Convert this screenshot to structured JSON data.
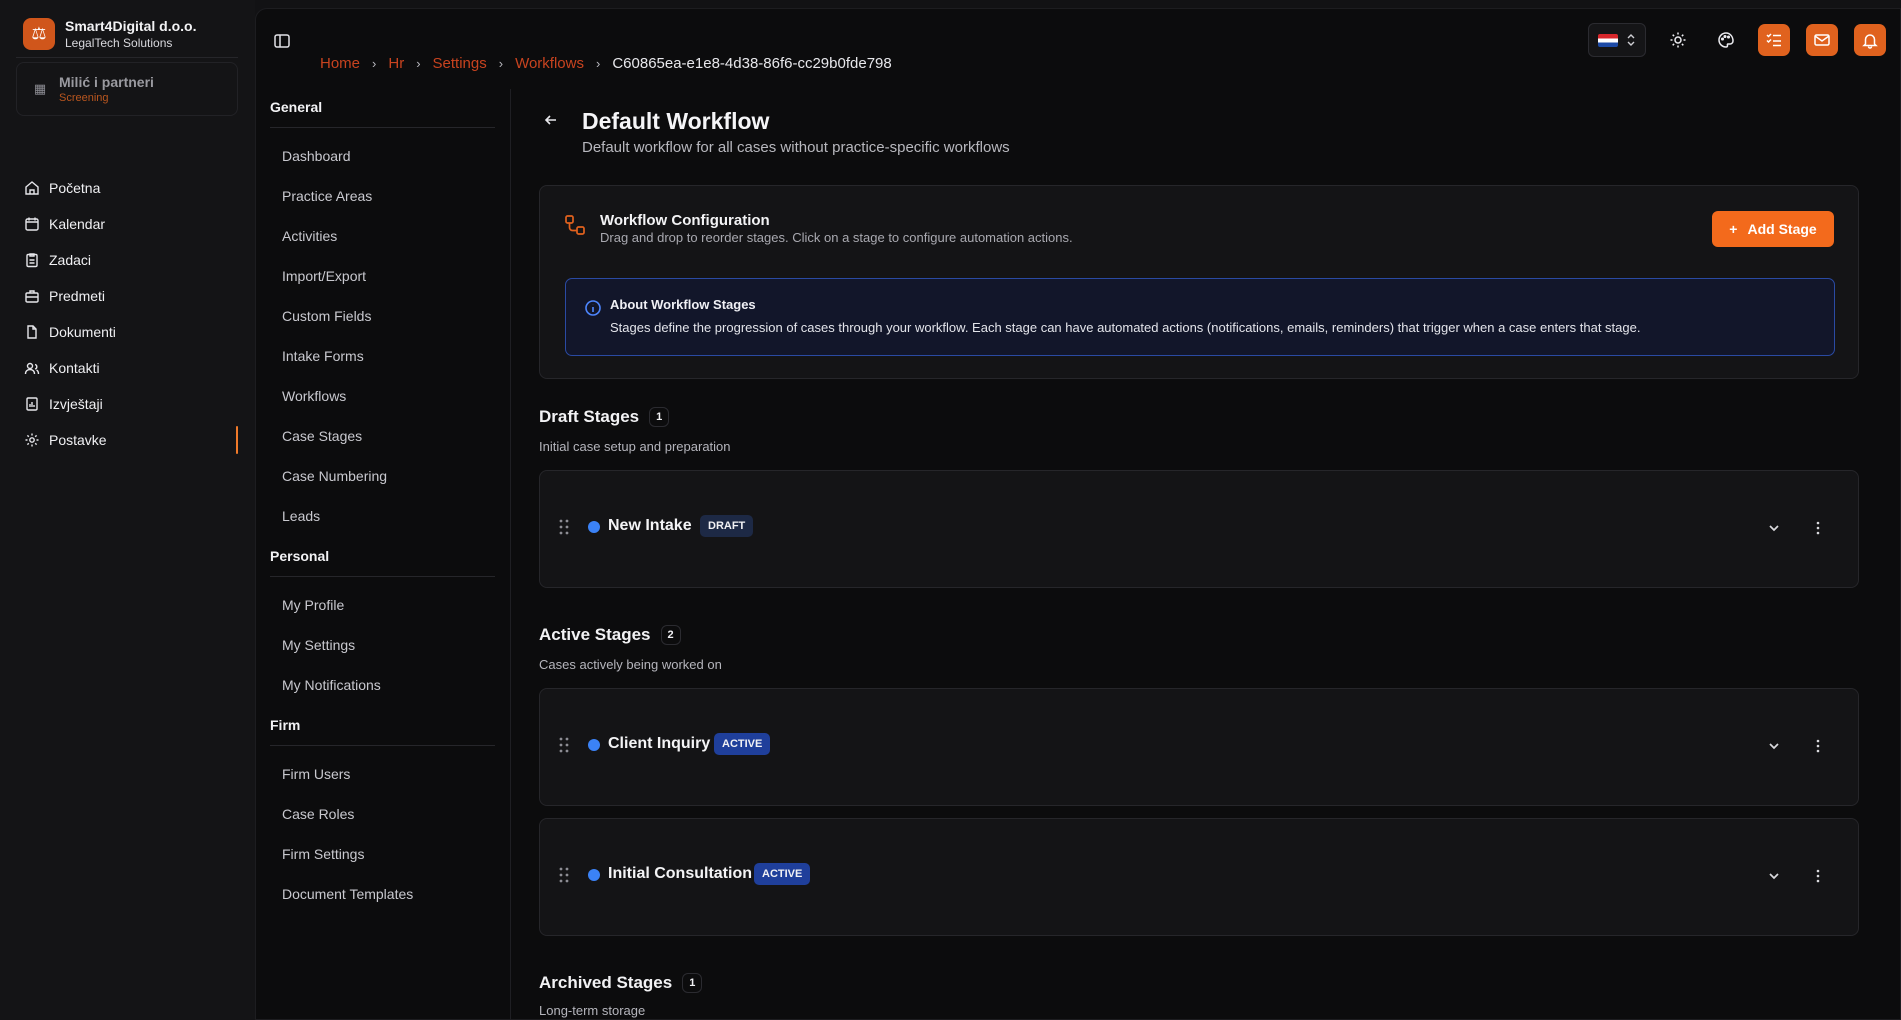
{
  "org": {
    "name": "Smart4Digital d.o.o.",
    "subtitle": "LegalTech Solutions"
  },
  "firm": {
    "name": "Milić i partneri",
    "status": "Screening"
  },
  "nav": [
    {
      "label": "Početna",
      "icon": "home-icon"
    },
    {
      "label": "Kalendar",
      "icon": "calendar-icon"
    },
    {
      "label": "Zadaci",
      "icon": "clipboard-icon"
    },
    {
      "label": "Predmeti",
      "icon": "briefcase-icon"
    },
    {
      "label": "Dokumenti",
      "icon": "file-icon"
    },
    {
      "label": "Kontakti",
      "icon": "users-icon"
    },
    {
      "label": "Izvještaji",
      "icon": "report-icon"
    },
    {
      "label": "Postavke",
      "icon": "gear-icon"
    }
  ],
  "breadcrumb": {
    "items": [
      "Home",
      "Hr",
      "Settings",
      "Workflows"
    ],
    "current": "C60865ea-e1e8-4d38-86f6-cc29b0fde798"
  },
  "settings_nav": {
    "general_title": "General",
    "general": [
      "Dashboard",
      "Practice Areas",
      "Activities",
      "Import/Export",
      "Custom Fields",
      "Intake Forms",
      "Workflows",
      "Case Stages",
      "Case Numbering",
      "Leads"
    ],
    "personal_title": "Personal",
    "personal": [
      "My Profile",
      "My Settings",
      "My Notifications"
    ],
    "firm_title": "Firm",
    "firm": [
      "Firm Users",
      "Case Roles",
      "Firm Settings",
      "Document Templates"
    ]
  },
  "page": {
    "title": "Default Workflow",
    "subtitle": "Default workflow for all cases without practice-specific workflows"
  },
  "config": {
    "title": "Workflow Configuration",
    "subtitle": "Drag and drop to reorder stages. Click on a stage to configure automation actions.",
    "add_label": "Add Stage",
    "info_title": "About Workflow Stages",
    "info_text": "Stages define the progression of cases through your workflow. Each stage can have automated actions (notifications, emails, reminders) that trigger when a case enters that stage."
  },
  "sections": {
    "draft": {
      "title": "Draft Stages",
      "count": "1",
      "subtitle": "Initial case setup and preparation"
    },
    "active": {
      "title": "Active Stages",
      "count": "2",
      "subtitle": "Cases actively being worked on"
    },
    "archived": {
      "title": "Archived Stages",
      "count": "1",
      "subtitle": "Long-term storage"
    }
  },
  "stages": [
    {
      "name": "New Intake",
      "badge": "DRAFT"
    },
    {
      "name": "Client Inquiry",
      "badge": "ACTIVE"
    },
    {
      "name": "Initial Consultation",
      "badge": "ACTIVE"
    }
  ],
  "colors": {
    "accent": "#f36a1c",
    "brand": "#d0561b",
    "info_border": "#2a4aa3",
    "stage_dot": "#3b82f6"
  }
}
